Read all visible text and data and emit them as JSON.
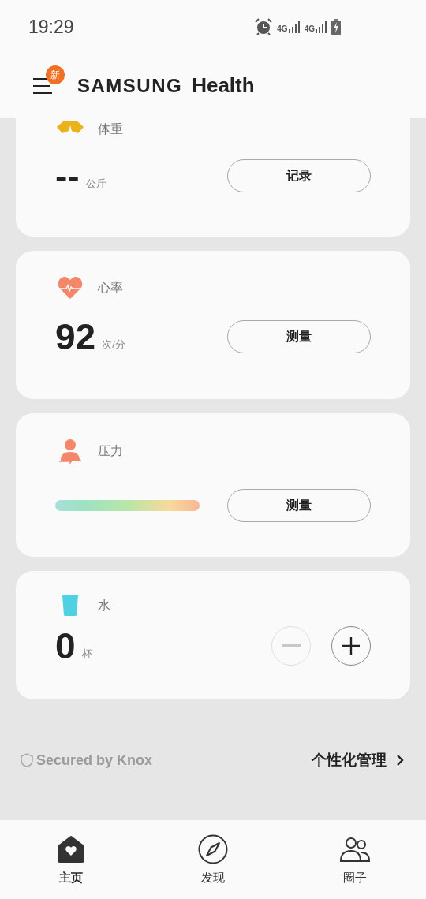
{
  "status_bar": {
    "time": "19:29",
    "networks": [
      "4G",
      "4G"
    ]
  },
  "header": {
    "menu_badge": "新",
    "brand": "SAMSUNG",
    "app": "Health"
  },
  "cards": [
    {
      "kind": "weight",
      "title": "体重",
      "value": "--",
      "unit": "公斤",
      "button": "记录"
    },
    {
      "kind": "heart",
      "title": "心率",
      "value": "92",
      "unit": "次/分",
      "button": "测量"
    },
    {
      "kind": "stress",
      "title": "压力",
      "button": "测量"
    },
    {
      "kind": "water",
      "title": "水",
      "value": "0",
      "unit": "杯",
      "decrease_disabled": true
    }
  ],
  "footer": {
    "knox": "Secured by Knox",
    "manage_link": "个性化管理"
  },
  "tabs": [
    {
      "kind": "home",
      "label": "主页",
      "selected": true
    },
    {
      "kind": "discover",
      "label": "发现",
      "selected": false
    },
    {
      "kind": "together",
      "label": "圈子",
      "selected": false
    }
  ]
}
